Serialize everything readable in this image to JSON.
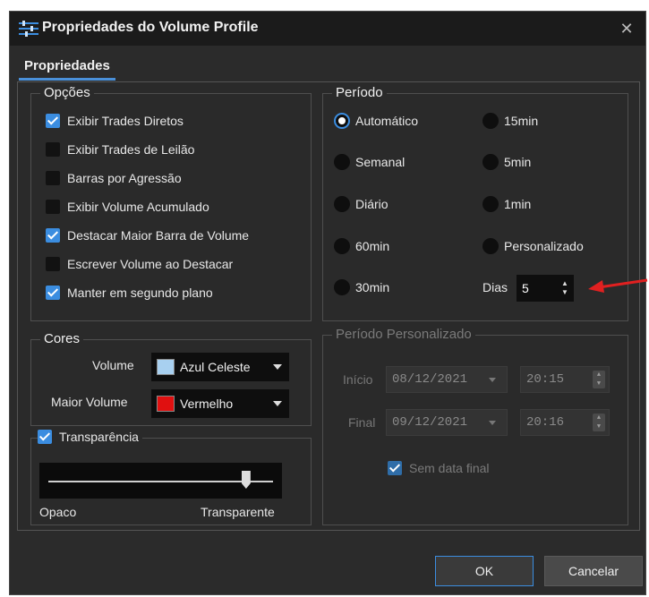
{
  "window": {
    "title": "Propriedades do Volume Profile",
    "close_glyph": "✕"
  },
  "tabs": [
    {
      "label": "Propriedades",
      "active": true
    }
  ],
  "opcoes": {
    "title": "Opções",
    "items": [
      {
        "label": "Exibir Trades Diretos",
        "checked": true
      },
      {
        "label": "Exibir Trades de Leilão",
        "checked": false
      },
      {
        "label": "Barras por Agressão",
        "checked": false
      },
      {
        "label": "Exibir Volume Acumulado",
        "checked": false
      },
      {
        "label": "Destacar Maior Barra de Volume",
        "checked": true
      },
      {
        "label": "Escrever Volume ao Destacar",
        "checked": false
      },
      {
        "label": "Manter em segundo plano",
        "checked": true
      }
    ]
  },
  "cores": {
    "title": "Cores",
    "volume_label": "Volume",
    "volume_value": "Azul Celeste",
    "volume_color": "#a8d0f0",
    "maior_label": "Maior Volume",
    "maior_value": "Vermelho",
    "maior_color": "#e01010"
  },
  "transparencia": {
    "label": "Transparência",
    "checked": true,
    "left_label": "Opaco",
    "right_label": "Transparente",
    "level": 0.88
  },
  "periodo": {
    "title": "Período",
    "options": [
      {
        "label": "Automático",
        "selected": true
      },
      {
        "label": "Semanal",
        "selected": false
      },
      {
        "label": "Diário",
        "selected": false
      },
      {
        "label": "60min",
        "selected": false
      },
      {
        "label": "30min",
        "selected": false
      },
      {
        "label": "15min",
        "selected": false
      },
      {
        "label": "5min",
        "selected": false
      },
      {
        "label": "1min",
        "selected": false
      },
      {
        "label": "Personalizado",
        "selected": false
      }
    ],
    "dias_label": "Dias",
    "dias_value": "5"
  },
  "periodo_personalizado": {
    "title": "Período Personalizado",
    "inicio_label": "Início",
    "inicio_date": "08/12/2021",
    "inicio_time": "20:15",
    "final_label": "Final",
    "final_date": "09/12/2021",
    "final_time": "20:16",
    "sem_data_final_label": "Sem data final",
    "sem_data_final_checked": true
  },
  "footer": {
    "ok_label": "OK",
    "cancel_label": "Cancelar"
  },
  "colors": {
    "accent": "#3b8de0",
    "annotation": "#e02020"
  }
}
